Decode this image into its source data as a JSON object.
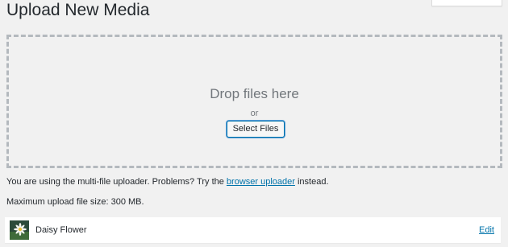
{
  "page": {
    "title": "Upload New Media"
  },
  "dropzone": {
    "title": "Drop files here",
    "or": "or",
    "select_button": "Select Files"
  },
  "uploader_note": {
    "before": "You are using the multi-file uploader. Problems? Try the ",
    "link": "browser uploader",
    "after": " instead."
  },
  "max_upload": "Maximum upload file size: 300 MB.",
  "media_items": [
    {
      "title": "Daisy Flower",
      "edit_label": "Edit",
      "thumbnail_icon": "daisy-photo"
    }
  ],
  "colors": {
    "background": "#f1f1f1",
    "link": "#0073aa",
    "dashed_border": "#b4b9be",
    "muted_text": "#72777c"
  }
}
